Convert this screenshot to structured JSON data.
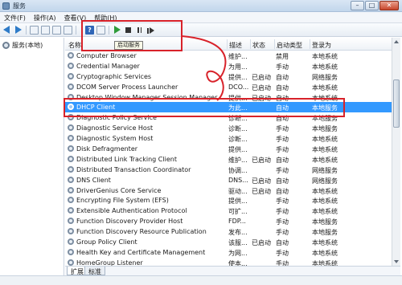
{
  "window": {
    "title": "服务",
    "buttons": {
      "minimize": "–",
      "maximize": "□",
      "close": "✕"
    }
  },
  "menu": [
    "文件(F)",
    "操作(A)",
    "查看(V)",
    "帮助(H)"
  ],
  "toolbar": {
    "help": "?",
    "tooltip": "启动服务"
  },
  "tree": {
    "root_label": "服务(本地)"
  },
  "columns": {
    "name": "名称",
    "desc": "描述",
    "status": "状态",
    "startup": "启动类型",
    "login": "登录为"
  },
  "services": [
    {
      "name": "Computer Browser",
      "desc": "维护...",
      "status": "",
      "startup": "禁用",
      "login": "本地系统"
    },
    {
      "name": "Credential Manager",
      "desc": "为用...",
      "status": "",
      "startup": "手动",
      "login": "本地系统"
    },
    {
      "name": "Cryptographic Services",
      "desc": "提供...",
      "status": "已启动",
      "startup": "自动",
      "login": "网络服务"
    },
    {
      "name": "DCOM Server Process Launcher",
      "desc": "DCO...",
      "status": "已启动",
      "startup": "自动",
      "login": "本地系统"
    },
    {
      "name": "Desktop Window Manager Session Manager",
      "desc": "提供...",
      "status": "已启动",
      "startup": "自动",
      "login": "本地系统"
    },
    {
      "name": "DHCP Client",
      "desc": "为此...",
      "status": "",
      "startup": "自动",
      "login": "本地服务",
      "selected": true
    },
    {
      "name": "Diagnostic Policy Service",
      "desc": "诊断...",
      "status": "",
      "startup": "自动",
      "login": "本地服务"
    },
    {
      "name": "Diagnostic Service Host",
      "desc": "诊断...",
      "status": "",
      "startup": "手动",
      "login": "本地服务"
    },
    {
      "name": "Diagnostic System Host",
      "desc": "诊断...",
      "status": "",
      "startup": "手动",
      "login": "本地系统"
    },
    {
      "name": "Disk Defragmenter",
      "desc": "提供...",
      "status": "",
      "startup": "手动",
      "login": "本地系统"
    },
    {
      "name": "Distributed Link Tracking Client",
      "desc": "维护...",
      "status": "已启动",
      "startup": "自动",
      "login": "本地系统"
    },
    {
      "name": "Distributed Transaction Coordinator",
      "desc": "协调...",
      "status": "",
      "startup": "手动",
      "login": "网络服务"
    },
    {
      "name": "DNS Client",
      "desc": "DNS...",
      "status": "已启动",
      "startup": "自动",
      "login": "网络服务"
    },
    {
      "name": "DriverGenius Core Service",
      "desc": "驱动...",
      "status": "已启动",
      "startup": "自动",
      "login": "本地系统"
    },
    {
      "name": "Encrypting File System (EFS)",
      "desc": "提供...",
      "status": "",
      "startup": "手动",
      "login": "本地系统"
    },
    {
      "name": "Extensible Authentication Protocol",
      "desc": "可扩...",
      "status": "",
      "startup": "手动",
      "login": "本地系统"
    },
    {
      "name": "Function Discovery Provider Host",
      "desc": "FDP...",
      "status": "",
      "startup": "手动",
      "login": "本地服务"
    },
    {
      "name": "Function Discovery Resource Publication",
      "desc": "发布...",
      "status": "",
      "startup": "手动",
      "login": "本地服务"
    },
    {
      "name": "Group Policy Client",
      "desc": "该服...",
      "status": "已启动",
      "startup": "自动",
      "login": "本地系统"
    },
    {
      "name": "Health Key and Certificate Management",
      "desc": "为网...",
      "status": "",
      "startup": "手动",
      "login": "本地系统"
    },
    {
      "name": "HomeGroup Listener",
      "desc": "使本...",
      "status": "",
      "startup": "手动",
      "login": "本地系统"
    }
  ],
  "tabs": [
    "扩展",
    "标准"
  ],
  "annotation_colors": {
    "highlight": "#d8222a"
  }
}
